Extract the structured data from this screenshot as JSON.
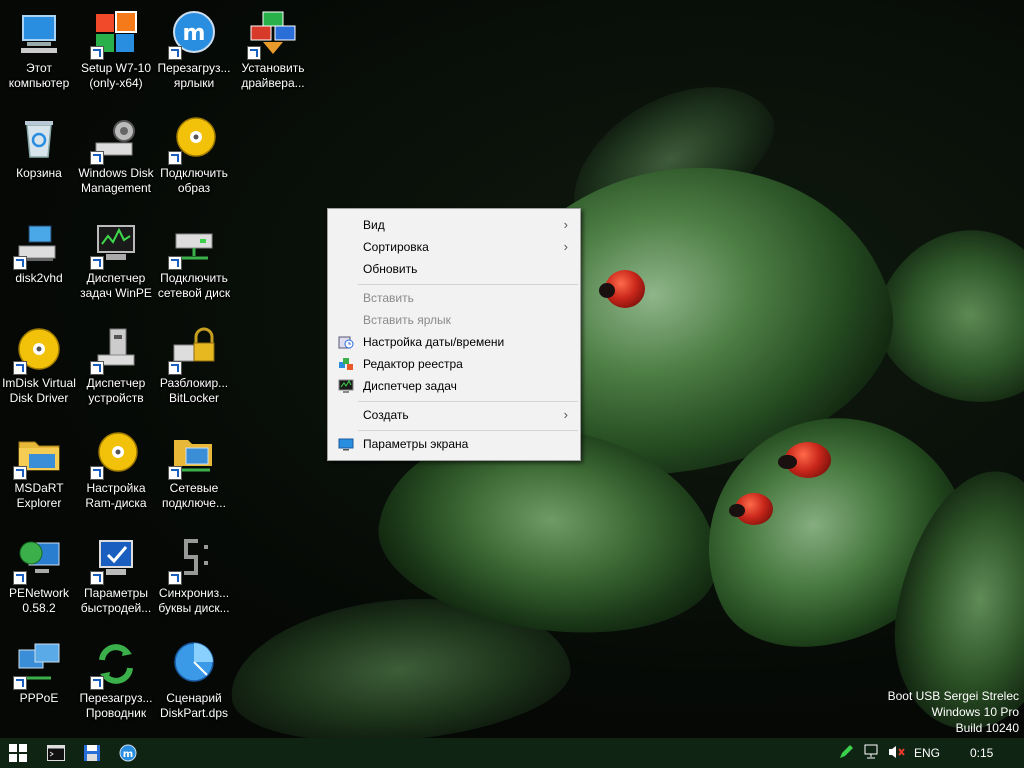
{
  "desktop": {
    "icons": [
      {
        "label": "Этот\nкомпьютер",
        "icon": "computer-icon"
      },
      {
        "label": "Setup W7-10\n(only-x64)",
        "icon": "windows-setup-icon"
      },
      {
        "label": "Перезагруз...\nярлыки",
        "icon": "refresh-shortcuts-icon"
      },
      {
        "label": "Установить\nдрайвера...",
        "icon": "driver-install-icon"
      },
      {
        "label": "Корзина",
        "icon": "recycle-bin-icon"
      },
      {
        "label": "Windows Disk\nManagement",
        "icon": "disk-management-icon"
      },
      {
        "label": "Подключить\nобраз",
        "icon": "mount-image-icon"
      },
      {
        "label": "disk2vhd",
        "icon": "disk2vhd-icon"
      },
      {
        "label": "Диспетчер\nзадач WinPE",
        "icon": "task-manager-icon"
      },
      {
        "label": "Подключить\nсетевой диск",
        "icon": "network-drive-icon"
      },
      {
        "label": "ImDisk Virtual\nDisk Driver",
        "icon": "imdisk-icon"
      },
      {
        "label": "Диспетчер\nустройств",
        "icon": "device-manager-icon"
      },
      {
        "label": "Разблокир...\nBitLocker",
        "icon": "bitlocker-icon"
      },
      {
        "label": "MSDaRT\nExplorer",
        "icon": "folder-icon"
      },
      {
        "label": "Настройка\nRam-диска",
        "icon": "ramdisk-icon"
      },
      {
        "label": "Сетевые\nподключе...",
        "icon": "network-connections-icon"
      },
      {
        "label": "PENetwork\n0.58.2",
        "icon": "penetwork-icon"
      },
      {
        "label": "Параметры\nбыстродей...",
        "icon": "performance-icon"
      },
      {
        "label": "Синхрониз...\nбуквы диск...",
        "icon": "sync-drive-letters-icon"
      },
      {
        "label": "PPPoE",
        "icon": "pppoe-icon"
      },
      {
        "label": "Перезагруз...\nПроводник",
        "icon": "restart-explorer-icon"
      },
      {
        "label": "Сценарий\nDiskPart.dps",
        "icon": "diskpart-icon"
      }
    ]
  },
  "context_menu": {
    "items": [
      {
        "label": "Вид",
        "submenu": true,
        "disabled": false
      },
      {
        "label": "Сортировка",
        "submenu": true,
        "disabled": false
      },
      {
        "label": "Обновить",
        "submenu": false,
        "disabled": false
      },
      {
        "label": "Вставить",
        "submenu": false,
        "disabled": true
      },
      {
        "label": "Вставить ярлык",
        "submenu": false,
        "disabled": true
      },
      {
        "label": "Настройка даты/времени",
        "submenu": false,
        "disabled": false,
        "icon": "datetime-icon"
      },
      {
        "label": "Редактор реестра",
        "submenu": false,
        "disabled": false,
        "icon": "registry-icon"
      },
      {
        "label": "Диспетчер задач",
        "submenu": false,
        "disabled": false,
        "icon": "task-manager-icon"
      },
      {
        "label": "Создать",
        "submenu": true,
        "disabled": false
      },
      {
        "label": "Параметры экрана",
        "submenu": false,
        "disabled": false,
        "icon": "display-icon"
      }
    ],
    "submenu_glyph": "›"
  },
  "watermark": {
    "line1": "Boot USB Sergei Strelec",
    "line2": "Windows 10 Pro",
    "line3": "Build 10240"
  },
  "taskbar": {
    "language": "ENG",
    "clock": "0:15",
    "pinned": [
      "cmd-icon",
      "save-icon",
      "mobaxterm-icon"
    ],
    "colors": {
      "background": "#102414",
      "accent": "#1a5fc0"
    }
  }
}
